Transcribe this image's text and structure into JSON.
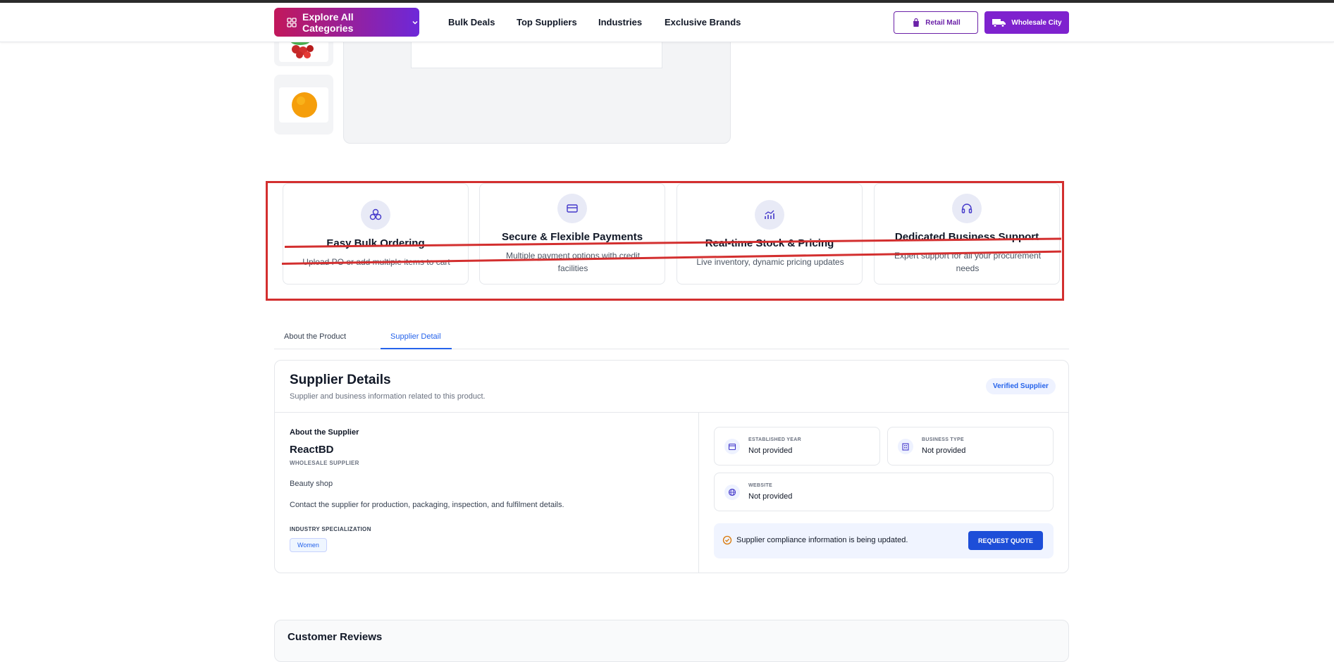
{
  "nav": {
    "explore_label": "Explore All Categories",
    "links": [
      "Bulk Deals",
      "Top Suppliers",
      "Industries",
      "Exclusive Brands"
    ],
    "retail_label": "Retail Mall",
    "wholesale_label": "Wholesale City"
  },
  "features": [
    {
      "title": "Easy Bulk Ordering",
      "desc": "Upload PO or add multiple items to cart",
      "icon": "bulk-order-icon"
    },
    {
      "title": "Secure & Flexible Payments",
      "desc": "Multiple payment options with credit facilities",
      "icon": "credit-card-icon"
    },
    {
      "title": "Real-time Stock & Pricing",
      "desc": "Live inventory, dynamic pricing updates",
      "icon": "chart-icon"
    },
    {
      "title": "Dedicated Business Support",
      "desc": "Expert support for all your procurement needs",
      "icon": "headset-icon"
    }
  ],
  "tabs": [
    "About the Product",
    "Supplier Detail"
  ],
  "supplier": {
    "title": "Supplier Details",
    "subtitle": "Supplier and business information related to this product.",
    "badge": "Verified Supplier",
    "about_label": "About the Supplier",
    "name": "ReactBD",
    "type": "WHOLESALE SUPPLIER",
    "desc": "Beauty shop",
    "contact": "Contact the supplier for production, packaging, inspection, and fulfilment details.",
    "industry_label": "INDUSTRY SPECIALIZATION",
    "industry_tag": "Women",
    "info": {
      "established_label": "ESTABLISHED YEAR",
      "established_value": "Not provided",
      "business_label": "BUSINESS TYPE",
      "business_value": "Not provided",
      "website_label": "WEBSITE",
      "website_value": "Not provided"
    },
    "compliance_text": "Supplier compliance information is being updated.",
    "quote_label": "REQUEST QUOTE"
  },
  "reviews": {
    "title": "Customer Reviews"
  }
}
